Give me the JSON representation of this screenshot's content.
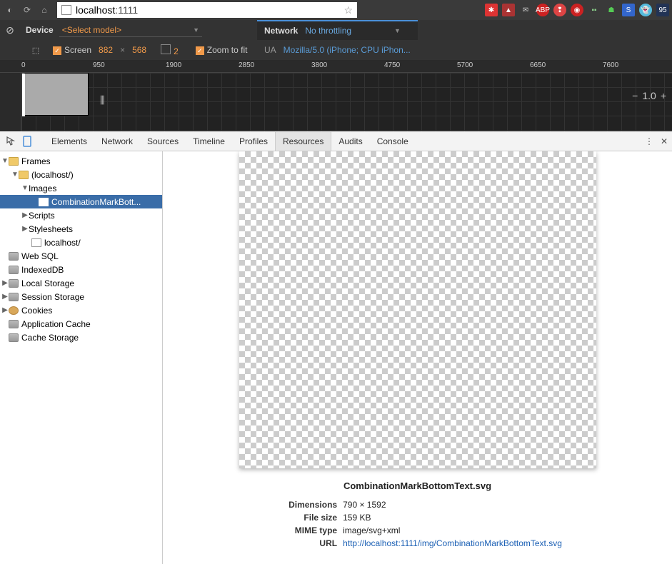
{
  "browser": {
    "url_host": "localhost",
    "url_port": ":1111"
  },
  "device_bar": {
    "device_label": "Device",
    "select_model": "<Select model>",
    "screen_label": "Screen",
    "width": "882",
    "x": "×",
    "height": "568",
    "pixel_ratio": "2",
    "zoom_label": "Zoom to fit",
    "network_label": "Network",
    "network_value": "No throttling",
    "ua_label": "UA",
    "ua_value": "Mozilla/5.0 (iPhone; CPU iPhon..."
  },
  "ruler": {
    "ticks": [
      "0",
      "950",
      "1900",
      "2850",
      "3800",
      "4750",
      "5700",
      "6650",
      "7600"
    ],
    "zoom": "1.0"
  },
  "devtools": {
    "tabs": [
      "Elements",
      "Network",
      "Sources",
      "Timeline",
      "Profiles",
      "Resources",
      "Audits",
      "Console"
    ],
    "active_tab": "Resources"
  },
  "tree": {
    "frames": "Frames",
    "localhost": "(localhost/)",
    "images": "Images",
    "selected_file": "CombinationMarkBott...",
    "scripts": "Scripts",
    "stylesheets": "Stylesheets",
    "localhost_file": "localhost/",
    "websql": "Web SQL",
    "indexeddb": "IndexedDB",
    "localstorage": "Local Storage",
    "sessionstorage": "Session Storage",
    "cookies": "Cookies",
    "appcache": "Application Cache",
    "cachestorage": "Cache Storage"
  },
  "resource": {
    "filename": "CombinationMarkBottomText.svg",
    "dimensions_label": "Dimensions",
    "dimensions_value": "790 × 1592",
    "filesize_label": "File size",
    "filesize_value": "159 KB",
    "mime_label": "MIME type",
    "mime_value": "image/svg+xml",
    "url_label": "URL",
    "url_value": "http://localhost:1111/img/CombinationMarkBottomText.svg"
  }
}
